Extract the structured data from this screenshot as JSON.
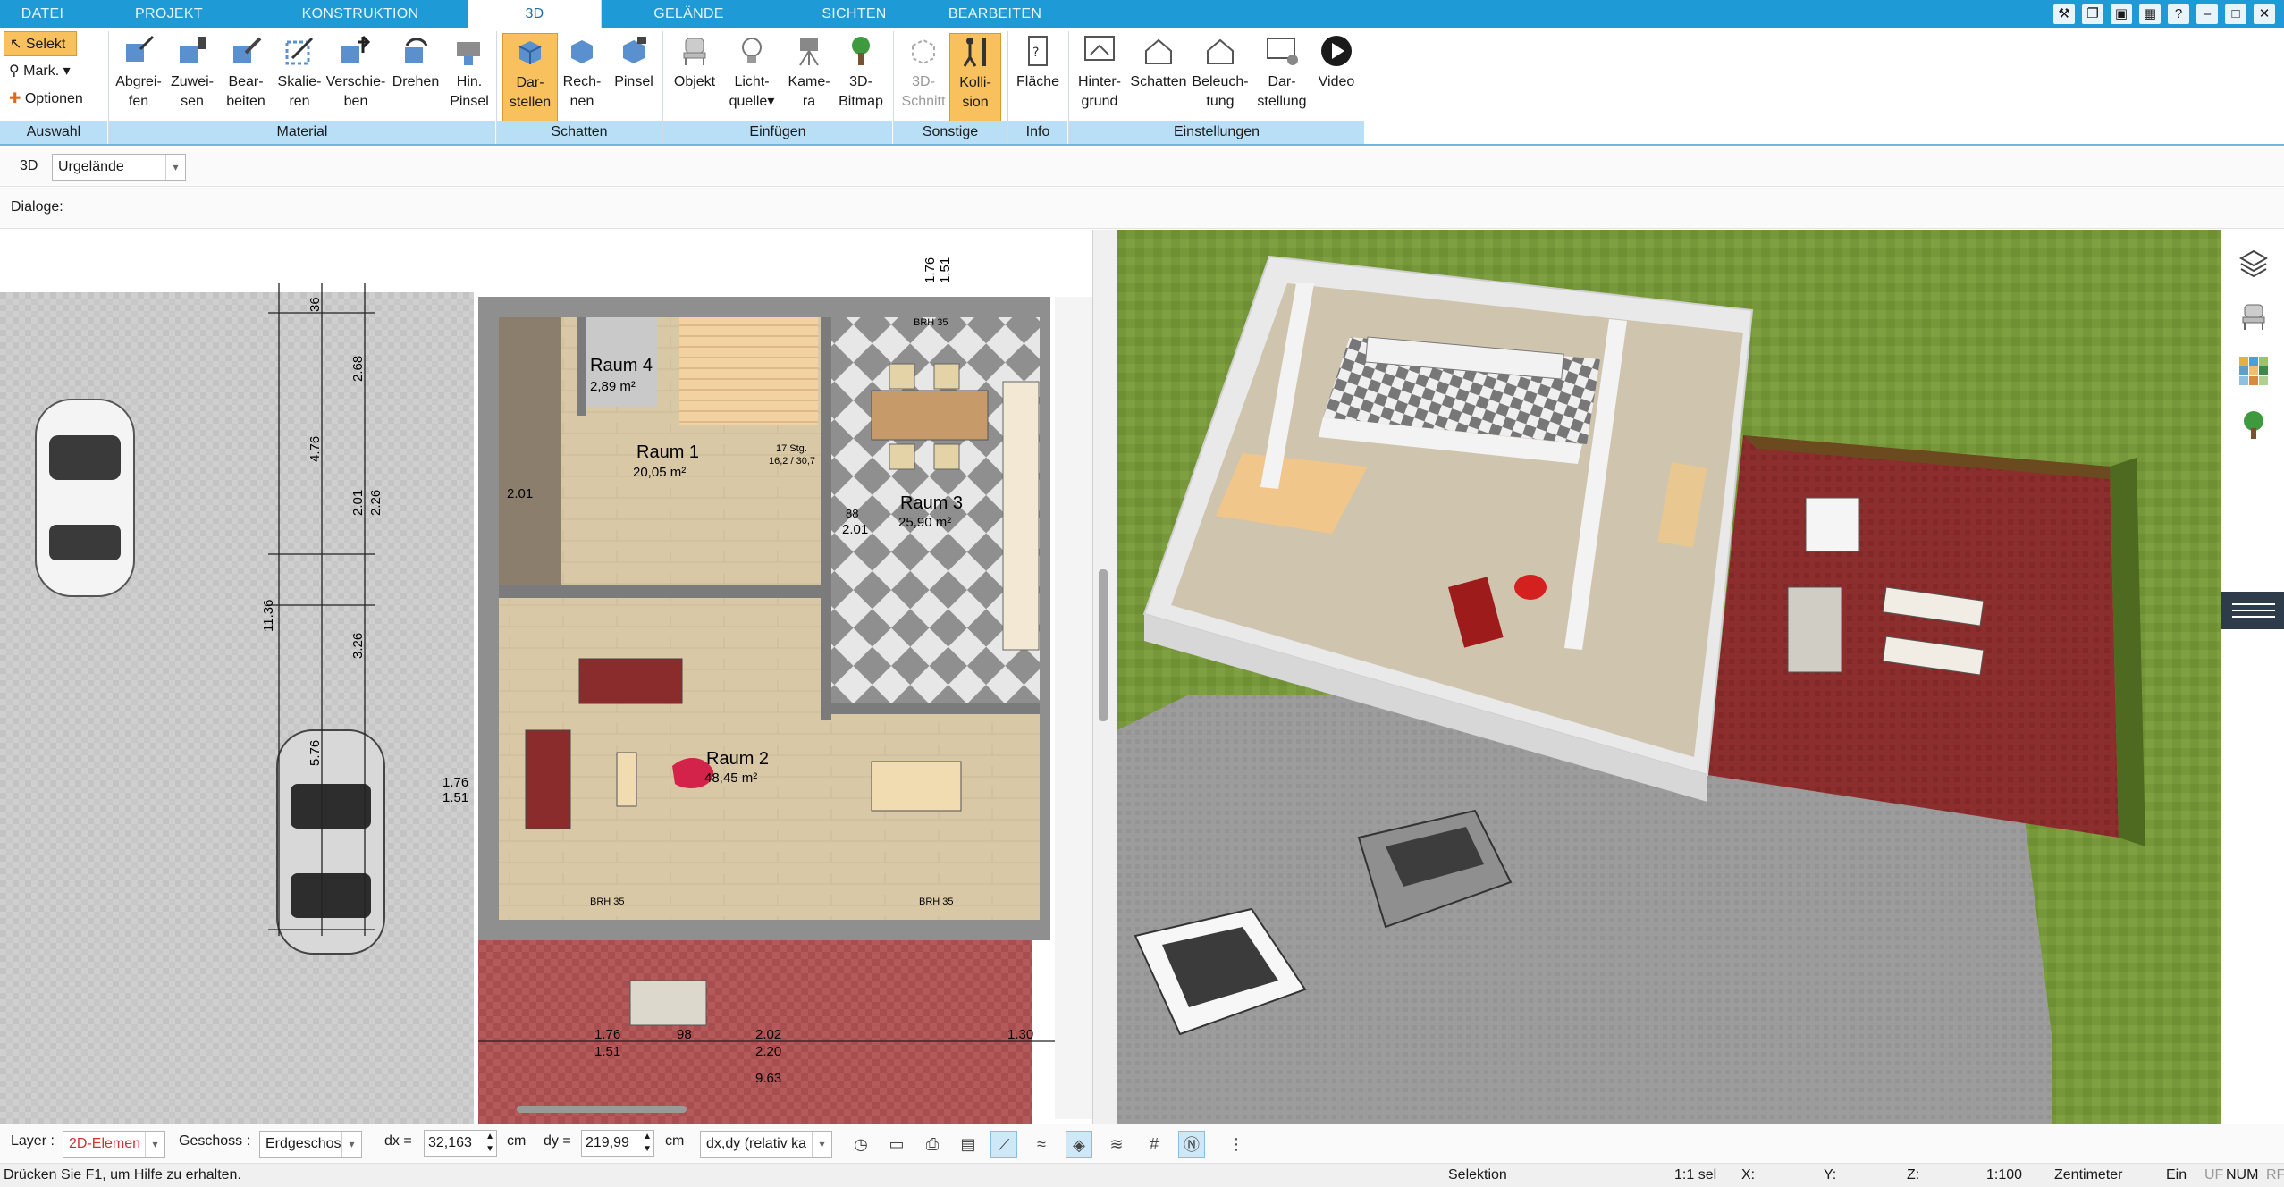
{
  "tabs": [
    {
      "label": "DATEI",
      "active": false
    },
    {
      "label": "PROJEKT",
      "active": false
    },
    {
      "label": "KONSTRUKTION",
      "active": false
    },
    {
      "label": "3D",
      "active": true
    },
    {
      "label": "GELÄNDE",
      "active": false
    },
    {
      "label": "SICHTEN",
      "active": false
    },
    {
      "label": "BEARBEITEN",
      "active": false
    }
  ],
  "window_controls": [
    "wrench-icon",
    "copy-icon",
    "restore-icon",
    "grid-icon",
    "help-icon",
    "minimize-icon",
    "maximize-icon",
    "close-icon"
  ],
  "ribbon": {
    "auswahl": {
      "items": [
        "Selekt",
        "Mark.",
        "Optionen"
      ],
      "group": "Auswahl"
    },
    "material": {
      "group": "Material",
      "buttons": [
        {
          "line1": "Abgrei-",
          "line2": "fen"
        },
        {
          "line1": "Zuwei-",
          "line2": "sen"
        },
        {
          "line1": "Bear-",
          "line2": "beiten"
        },
        {
          "line1": "Skalie-",
          "line2": "ren"
        },
        {
          "line1": "Verschie-",
          "line2": "ben"
        },
        {
          "line1": "Drehen",
          "line2": ""
        },
        {
          "line1": "Hin.",
          "line2": "Pinsel"
        }
      ]
    },
    "schatten": {
      "group": "Schatten",
      "buttons": [
        {
          "line1": "Dar-",
          "line2": "stellen"
        },
        {
          "line1": "Rech-",
          "line2": "nen"
        },
        {
          "line1": "Pinsel",
          "line2": ""
        }
      ]
    },
    "einfuegen": {
      "group": "Einfügen",
      "buttons": [
        {
          "line1": "Objekt",
          "line2": ""
        },
        {
          "line1": "Licht-",
          "line2": "quelle"
        },
        {
          "line1": "Kame-",
          "line2": "ra"
        },
        {
          "line1": "3D-",
          "line2": "Bitmap"
        }
      ]
    },
    "sonstige": {
      "group": "Sonstige",
      "buttons": [
        {
          "line1": "3D-",
          "line2": "Schnitt"
        },
        {
          "line1": "Kolli-",
          "line2": "sion"
        }
      ]
    },
    "info": {
      "group": "Info",
      "buttons": [
        {
          "line1": "Fläche",
          "line2": ""
        }
      ]
    },
    "einstellungen": {
      "group": "Einstellungen",
      "buttons": [
        {
          "line1": "Hinter-",
          "line2": "grund"
        },
        {
          "line1": "Schatten",
          "line2": ""
        },
        {
          "line1": "Beleuch-",
          "line2": "tung"
        },
        {
          "line1": "Dar-",
          "line2": "stellung"
        },
        {
          "line1": "Video",
          "line2": ""
        }
      ]
    }
  },
  "viewbar": {
    "mode": "3D",
    "terrain": "Urgelände"
  },
  "dialogbar": {
    "label": "Dialoge:"
  },
  "plan": {
    "rooms": [
      {
        "name": "Raum 4",
        "area": "2,89 m²"
      },
      {
        "name": "Raum 1",
        "area": "20,05 m²"
      },
      {
        "name": "Raum 3",
        "area": "25,90 m²"
      },
      {
        "name": "Raum 2",
        "area": "48,45 m²"
      }
    ],
    "dims": {
      "d1": "1.76",
      "d2": "1.51",
      "d3": "36",
      "d4": "2.68",
      "d5": "4.76",
      "d6": "2.01",
      "d7": "2.26",
      "d8": "11.36",
      "d9": "3.26",
      "d10": "5.76",
      "d11": "1.76",
      "d12": "1.51",
      "d13": "2.02",
      "d14": "2.20",
      "d15": "1.30",
      "d16": "9.63",
      "d17": "98",
      "d18": "88",
      "d19": "2.01",
      "stair": "17 Stg.",
      "stair2": "16,2 / 30,7",
      "brh": "BRH 35"
    }
  },
  "bottom": {
    "layer_label": "Layer :",
    "layer_value": "2D-Elemen",
    "geschoss_label": "Geschoss :",
    "geschoss_value": "Erdgeschos",
    "dx_label": "dx =",
    "dx_value": "32,163",
    "dx_unit": "cm",
    "dy_label": "dy =",
    "dy_value": "219,99",
    "dy_unit": "cm",
    "mode_value": "dx,dy (relativ ka"
  },
  "status": {
    "help": "Drücken Sie F1, um Hilfe zu erhalten.",
    "mode": "Selektion",
    "sel": "1:1 sel",
    "x": "X:",
    "y": "Y:",
    "z": "Z:",
    "scale": "1:100",
    "unit": "Zentimeter",
    "ein": "Ein",
    "uf": "UF",
    "num": "NUM",
    "rf": "RF"
  },
  "colors": {
    "accent": "#1e9ad6",
    "ribbon_group": "#b9dff6",
    "selected": "#f8c15e"
  }
}
